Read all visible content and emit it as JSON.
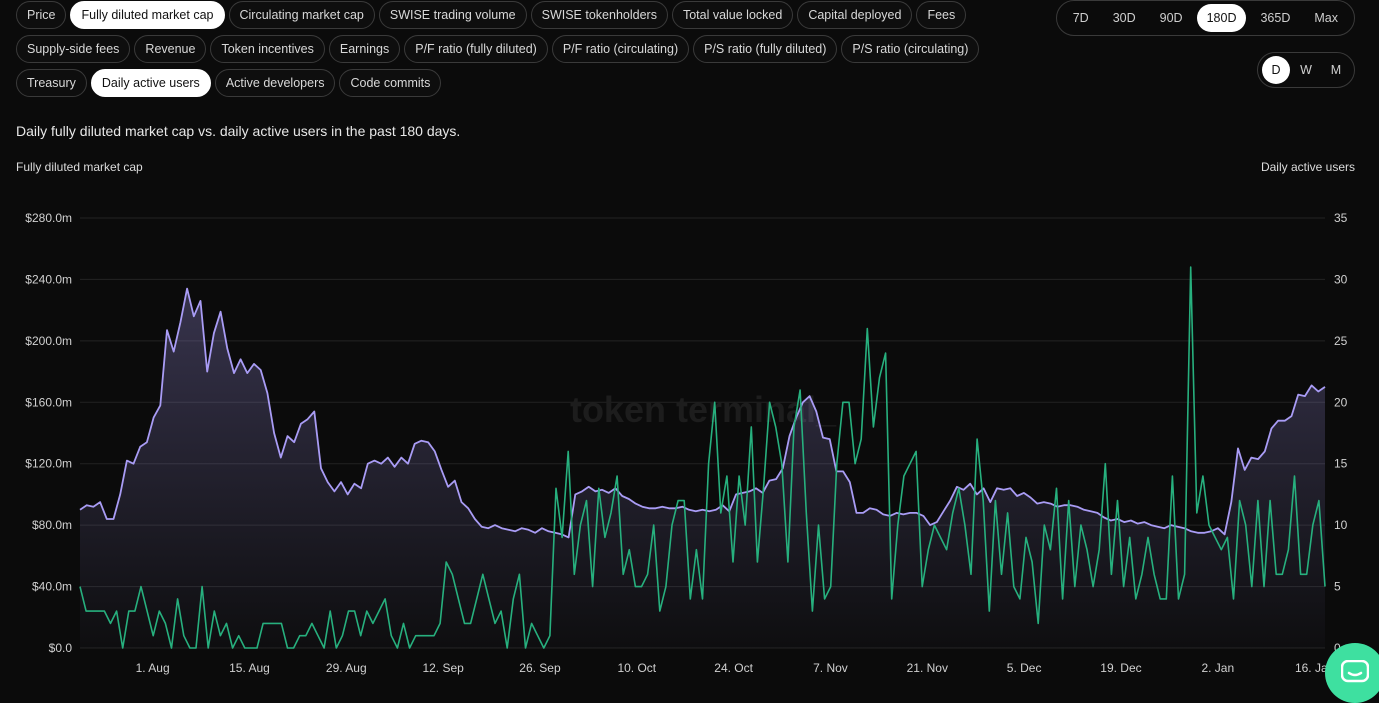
{
  "metric_chips": [
    [
      {
        "label": "Price",
        "active": false
      },
      {
        "label": "Fully diluted market cap",
        "active": true
      },
      {
        "label": "Circulating market cap",
        "active": false
      },
      {
        "label": "SWISE trading volume",
        "active": false
      },
      {
        "label": "SWISE tokenholders",
        "active": false
      },
      {
        "label": "Total value locked",
        "active": false
      },
      {
        "label": "Capital deployed",
        "active": false
      },
      {
        "label": "Fees",
        "active": false
      }
    ],
    [
      {
        "label": "Supply-side fees",
        "active": false
      },
      {
        "label": "Revenue",
        "active": false
      },
      {
        "label": "Token incentives",
        "active": false
      },
      {
        "label": "Earnings",
        "active": false
      },
      {
        "label": "P/F ratio (fully diluted)",
        "active": false
      },
      {
        "label": "P/F ratio (circulating)",
        "active": false
      },
      {
        "label": "P/S ratio (fully diluted)",
        "active": false
      },
      {
        "label": "P/S ratio (circulating)",
        "active": false
      }
    ],
    [
      {
        "label": "Treasury",
        "active": false
      },
      {
        "label": "Daily active users",
        "active": true
      },
      {
        "label": "Active developers",
        "active": false
      },
      {
        "label": "Code commits",
        "active": false
      }
    ]
  ],
  "range_options": [
    {
      "label": "7D",
      "active": false
    },
    {
      "label": "30D",
      "active": false
    },
    {
      "label": "90D",
      "active": false
    },
    {
      "label": "180D",
      "active": true
    },
    {
      "label": "365D",
      "active": false
    },
    {
      "label": "Max",
      "active": false
    }
  ],
  "granularity_options": [
    {
      "label": "D",
      "active": true
    },
    {
      "label": "W",
      "active": false
    },
    {
      "label": "M",
      "active": false
    }
  ],
  "description": "Daily fully diluted market cap vs. daily active users in the past 180 days.",
  "colors": {
    "market_cap_line": "#a99cf5",
    "users_line": "#27b07e",
    "grid": "#232323",
    "chat_button": "#3ee0a0"
  },
  "icons": {
    "chat": "chat-bubble-icon"
  },
  "chart_data": {
    "type": "line",
    "watermark": "token terminal_",
    "y_left": {
      "label": "Fully diluted market cap",
      "min": 0,
      "max": 280,
      "unit": "$m",
      "ticks": [
        "$0.0",
        "$40.0m",
        "$80.0m",
        "$120.0m",
        "$160.0m",
        "$200.0m",
        "$240.0m",
        "$280.0m"
      ]
    },
    "y_right": {
      "label": "Daily active users",
      "min": 0,
      "max": 35,
      "ticks": [
        "0",
        "5",
        "10",
        "15",
        "20",
        "25",
        "30",
        "35"
      ]
    },
    "x_ticks": [
      "1. Aug",
      "15. Aug",
      "29. Aug",
      "12. Sep",
      "26. Sep",
      "10. Oct",
      "24. Oct",
      "7. Nov",
      "21. Nov",
      "5. Dec",
      "19. Dec",
      "2. Jan",
      "16. Jan"
    ],
    "x_days_total": 180,
    "series": [
      {
        "name": "Fully diluted market cap",
        "axis": "left",
        "values": [
          90,
          93,
          92,
          95,
          84,
          84,
          100,
          122,
          120,
          131,
          134,
          150,
          158,
          207,
          193,
          212,
          234,
          216,
          226,
          180,
          205,
          219,
          195,
          179,
          188,
          179,
          185,
          181,
          166,
          140,
          124,
          138,
          134,
          146,
          149,
          154,
          117,
          108,
          102,
          108,
          100,
          107,
          104,
          120,
          122,
          120,
          124,
          118,
          124,
          120,
          133,
          135,
          134,
          128,
          116,
          105,
          109,
          95,
          91,
          84,
          79,
          78,
          80,
          78,
          77,
          76,
          78,
          77,
          75,
          78,
          76,
          75,
          74,
          72,
          100,
          102,
          105,
          102,
          103,
          101,
          104,
          99,
          97,
          94,
          92,
          91,
          91,
          92,
          91,
          91,
          92,
          90,
          89,
          90,
          89,
          90,
          93,
          89,
          100,
          101,
          102,
          104,
          101,
          109,
          110,
          117,
          138,
          150,
          160,
          164,
          154,
          137,
          136,
          115,
          115,
          108,
          88,
          88,
          91,
          90,
          87,
          86,
          88,
          87,
          88,
          88,
          86,
          80,
          82,
          89,
          96,
          105,
          103,
          107,
          100,
          104,
          95,
          104,
          103,
          104,
          99,
          101,
          98,
          94,
          95,
          94,
          92,
          93,
          93,
          92,
          90,
          89,
          88,
          85,
          83,
          84,
          82,
          83,
          81,
          82,
          80,
          79,
          78,
          80,
          79,
          78,
          76,
          75,
          75,
          76,
          78,
          74,
          95,
          130,
          116,
          124,
          123,
          128,
          143,
          148,
          148,
          151,
          165,
          164,
          171,
          167,
          170
        ],
        "values_approx": true
      },
      {
        "name": "Daily active users",
        "axis": "right",
        "values": [
          5,
          3,
          3,
          3,
          3,
          2,
          3,
          0,
          3,
          3,
          5,
          3,
          1,
          3,
          2,
          0,
          4,
          1,
          0,
          0,
          5,
          0,
          3,
          1,
          2,
          0,
          1,
          0,
          0,
          0,
          2,
          2,
          2,
          2,
          0,
          0,
          1,
          1,
          2,
          1,
          0,
          3,
          0,
          1,
          3,
          3,
          1,
          3,
          2,
          3,
          4,
          1,
          0,
          2,
          0,
          1,
          1,
          1,
          1,
          2,
          7,
          6,
          4,
          2,
          2,
          4,
          6,
          4,
          2,
          3,
          0,
          4,
          6,
          0,
          2,
          1,
          0,
          1,
          13,
          9,
          16,
          6,
          10,
          12,
          5,
          13,
          9,
          11,
          14,
          6,
          8,
          5,
          5,
          6,
          10,
          3,
          5,
          10,
          12,
          12,
          4,
          8,
          4,
          15,
          20,
          11,
          14,
          7,
          14,
          10,
          18,
          7,
          13,
          20,
          18,
          15,
          7,
          18,
          21,
          11,
          3,
          10,
          4,
          5,
          15,
          20,
          20,
          15,
          17,
          26,
          18,
          22,
          24,
          4,
          10,
          14,
          15,
          16,
          5,
          8,
          10,
          9,
          8,
          11,
          13,
          10,
          6,
          17,
          12,
          3,
          12,
          6,
          11,
          5,
          4,
          9,
          7,
          2,
          10,
          8,
          13,
          4,
          12,
          5,
          10,
          8,
          5,
          8,
          15,
          6,
          12,
          5,
          9,
          4,
          6,
          9,
          6,
          4,
          4,
          14,
          4,
          6,
          31,
          11,
          14,
          10,
          9,
          8,
          9,
          4,
          12,
          10,
          5,
          12,
          5,
          12,
          6,
          6,
          8,
          14,
          6,
          6,
          10,
          12,
          5
        ],
        "values_approx": true
      }
    ],
    "grid": true,
    "legend": "none"
  }
}
